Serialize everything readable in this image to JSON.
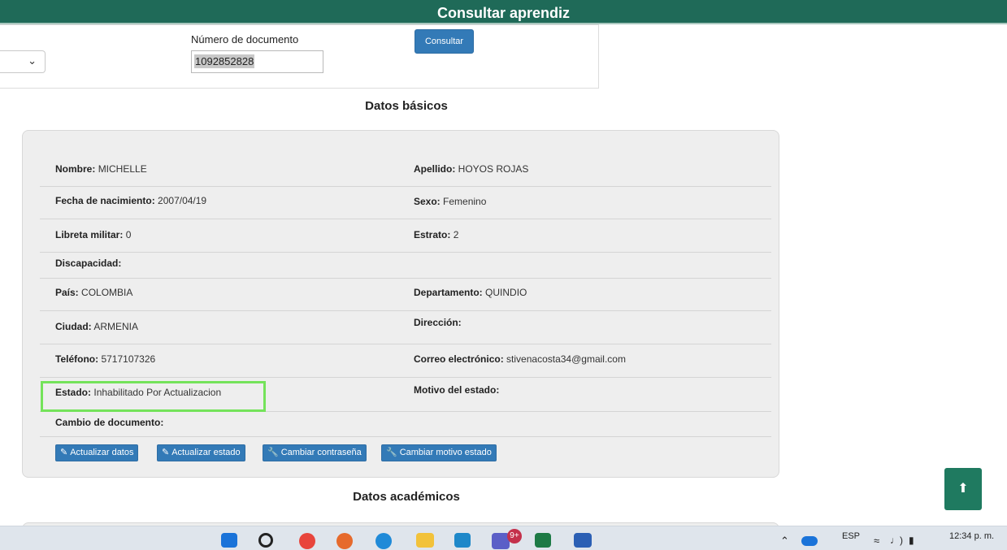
{
  "header": {
    "title": "Consultar aprendiz"
  },
  "search": {
    "doc_label": "Número de documento",
    "doc_value": "1092852828",
    "submit_label": "Consultar"
  },
  "basic": {
    "title": "Datos básicos",
    "nombre_label": "Nombre:",
    "nombre": "MICHELLE",
    "apellido_label": "Apellido:",
    "apellido": "HOYOS ROJAS",
    "fecha_label": "Fecha de nacimiento:",
    "fecha": "2007/04/19",
    "sexo_label": "Sexo:",
    "sexo": "Femenino",
    "libreta_label": "Libreta militar:",
    "libreta": "0",
    "estrato_label": "Estrato:",
    "estrato": "2",
    "discapacidad_label": "Discapacidad:",
    "pais_label": "País:",
    "pais": "COLOMBIA",
    "departamento_label": "Departamento:",
    "departamento": "QUINDIO",
    "ciudad_label": "Ciudad:",
    "ciudad": "ARMENIA",
    "direccion_label": "Dirección:",
    "telefono_label": "Teléfono:",
    "telefono": "5717107326",
    "correo_label": "Correo electrónico:",
    "correo": "stivenacosta34@gmail.com",
    "estado_label": "Estado:",
    "estado": "Inhabilitado Por Actualizacion",
    "motivo_label": "Motivo del estado:",
    "cambio_label": "Cambio de documento:"
  },
  "actions": {
    "actualizar_datos": "Actualizar datos",
    "actualizar_estado": "Actualizar estado",
    "cambiar_contrasena": "Cambiar contraseña",
    "cambiar_motivo": "Cambiar motivo estado"
  },
  "academic": {
    "title": "Datos académicos"
  },
  "taskbar": {
    "badge": "9+",
    "language": "ESP",
    "time": "12:34 p. m."
  },
  "colors": {
    "header_bg": "#1f6a58",
    "button_primary": "#337ab7",
    "highlight_border": "#74e35a",
    "scroll_top_bg": "#1f7a60"
  }
}
